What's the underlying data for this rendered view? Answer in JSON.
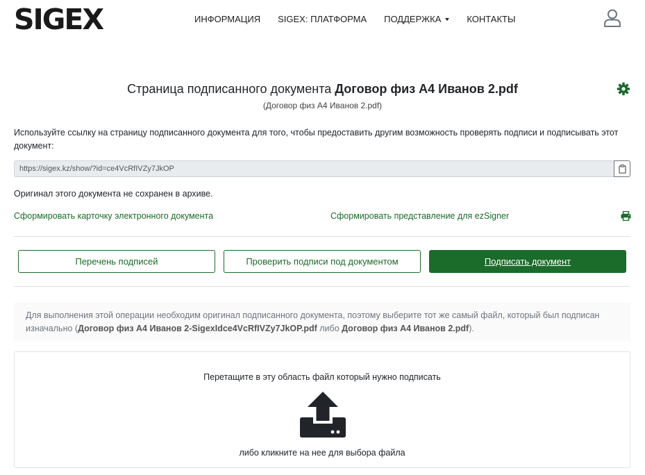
{
  "brand": {
    "logo_text": "SIGEX",
    "accent": "#1b6b2a"
  },
  "nav": {
    "items": [
      {
        "label": "ИНФОРМАЦИЯ"
      },
      {
        "label": "SIGEX: ПЛАТФОРМА"
      },
      {
        "label": "ПОДДЕРЖКА"
      },
      {
        "label": "КОНТАКТЫ"
      }
    ],
    "user_icon": "user-icon"
  },
  "document": {
    "title_prefix": "Страница подписанного документа",
    "title_name": "Договор физ А4 Иванов 2.pdf",
    "subtitle": "(Договор физ А4 Иванов 2.pdf)",
    "settings_icon": "gear-icon",
    "description": "Используйте ссылку на страницу подписанного документа для того, чтобы предоставить другим возможность проверять подписи и подписывать этот документ:",
    "share_link": "https://sigex.kz/show/?id=ce4VcRfIVZy7JkOP",
    "copy_icon": "clipboard-icon",
    "not_saved_text": "Оригинал этого документа не сохранен в архиве."
  },
  "links": {
    "card": "Сформировать карточку электронного документа",
    "ezsigner": "Сформировать представление для ezSigner",
    "print_icon": "printer-icon"
  },
  "actions": {
    "signatures_list": "Перечень подписей",
    "verify": "Проверить подписи под документом",
    "sign": "Подписать документ"
  },
  "notice": {
    "part1": "Для выполнения этой операции необходим оригинал подписанного документа, поэтому выберите тот же самый файл, который был подписан изначально (",
    "file1": "Договор физ А4 Иванов 2-SigexIdce4VcRfIVZy7JkOP.pdf",
    "part2": " либо ",
    "file2": "Договор физ А4 Иванов 2.pdf",
    "part3": ")."
  },
  "dropzone": {
    "top_text": "Перетащите в эту область файл который нужно подписать",
    "bottom_text": "либо кликните на нее для выбора файла",
    "icon": "upload-icon"
  }
}
